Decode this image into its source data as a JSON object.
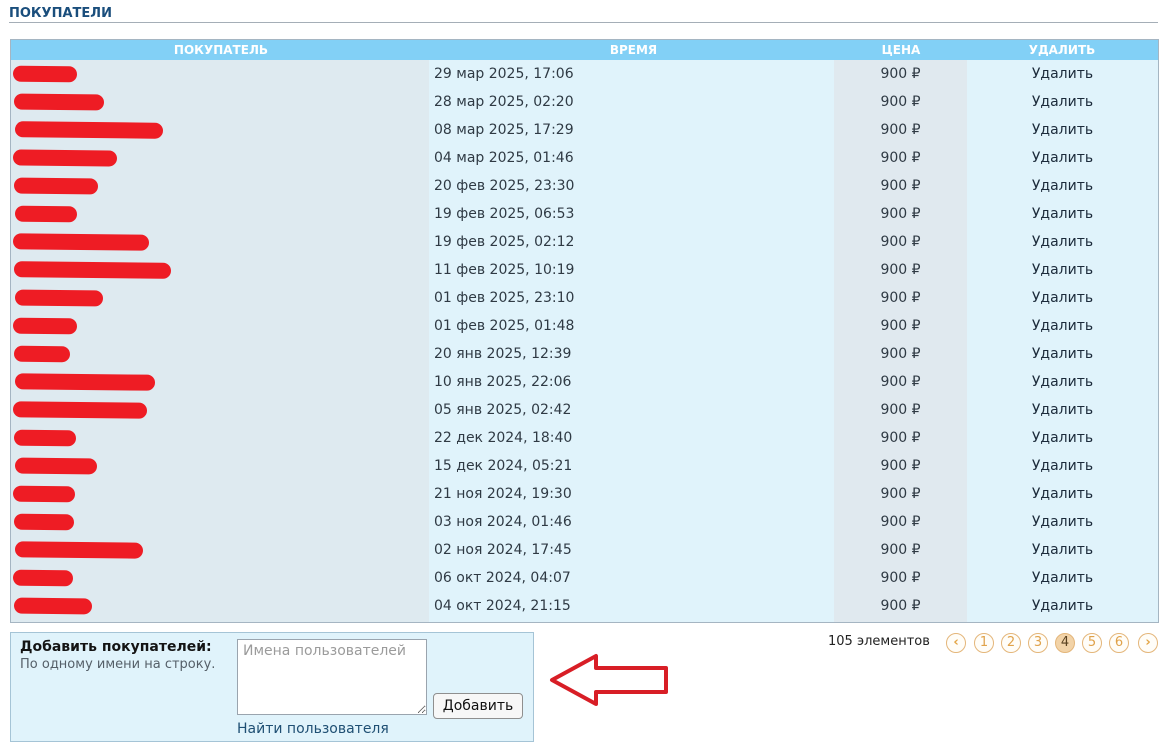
{
  "section": {
    "title": "ПОКУПАТЕЛИ"
  },
  "table": {
    "headers": {
      "buyer": "ПОКУПАТЕЛЬ",
      "time": "ВРЕМЯ",
      "price": "ЦЕНА",
      "delete": "УДАЛИТЬ"
    },
    "rows": [
      {
        "time": "29 мар 2025, 17:06",
        "price": "900 ₽",
        "delete": "Удалить"
      },
      {
        "time": "28 мар 2025, 02:20",
        "price": "900 ₽",
        "delete": "Удалить"
      },
      {
        "time": "08 мар 2025, 17:29",
        "price": "900 ₽",
        "delete": "Удалить"
      },
      {
        "time": "04 мар 2025, 01:46",
        "price": "900 ₽",
        "delete": "Удалить"
      },
      {
        "time": "20 фев 2025, 23:30",
        "price": "900 ₽",
        "delete": "Удалить"
      },
      {
        "time": "19 фев 2025, 06:53",
        "price": "900 ₽",
        "delete": "Удалить"
      },
      {
        "time": "19 фев 2025, 02:12",
        "price": "900 ₽",
        "delete": "Удалить"
      },
      {
        "time": "11 фев 2025, 10:19",
        "price": "900 ₽",
        "delete": "Удалить"
      },
      {
        "time": "01 фев 2025, 23:10",
        "price": "900 ₽",
        "delete": "Удалить"
      },
      {
        "time": "01 фев 2025, 01:48",
        "price": "900 ₽",
        "delete": "Удалить"
      },
      {
        "time": "20 янв 2025, 12:39",
        "price": "900 ₽",
        "delete": "Удалить"
      },
      {
        "time": "10 янв 2025, 22:06",
        "price": "900 ₽",
        "delete": "Удалить"
      },
      {
        "time": "05 янв 2025, 02:42",
        "price": "900 ₽",
        "delete": "Удалить"
      },
      {
        "time": "22 дек 2024, 18:40",
        "price": "900 ₽",
        "delete": "Удалить"
      },
      {
        "time": "15 дек 2024, 05:21",
        "price": "900 ₽",
        "delete": "Удалить"
      },
      {
        "time": "21 ноя 2024, 19:30",
        "price": "900 ₽",
        "delete": "Удалить"
      },
      {
        "time": "03 ноя 2024, 01:46",
        "price": "900 ₽",
        "delete": "Удалить"
      },
      {
        "time": "02 ноя 2024, 17:45",
        "price": "900 ₽",
        "delete": "Удалить"
      },
      {
        "time": "06 окт 2024, 04:07",
        "price": "900 ₽",
        "delete": "Удалить"
      },
      {
        "time": "04 окт 2024, 21:15",
        "price": "900 ₽",
        "delete": "Удалить"
      }
    ]
  },
  "add_form": {
    "label": "Добавить покупателей:",
    "hint": "По одному имени на строку.",
    "placeholder": "Имена пользователей",
    "value": "",
    "button": "Добавить",
    "find_link": "Найти пользователя"
  },
  "pagination": {
    "count": "105 элементов",
    "pages": [
      "1",
      "2",
      "3",
      "4",
      "5",
      "6"
    ],
    "current": "4",
    "prev_icon": "chevron-left-icon",
    "next_icon": "chevron-right-icon"
  },
  "colors": {
    "header_bg": "#82d0f6",
    "row_bg": "#e0f3fb",
    "redaction": "#ee1c24",
    "annotation_arrow": "#d81e26",
    "pager_accent": "#e0a24a"
  }
}
